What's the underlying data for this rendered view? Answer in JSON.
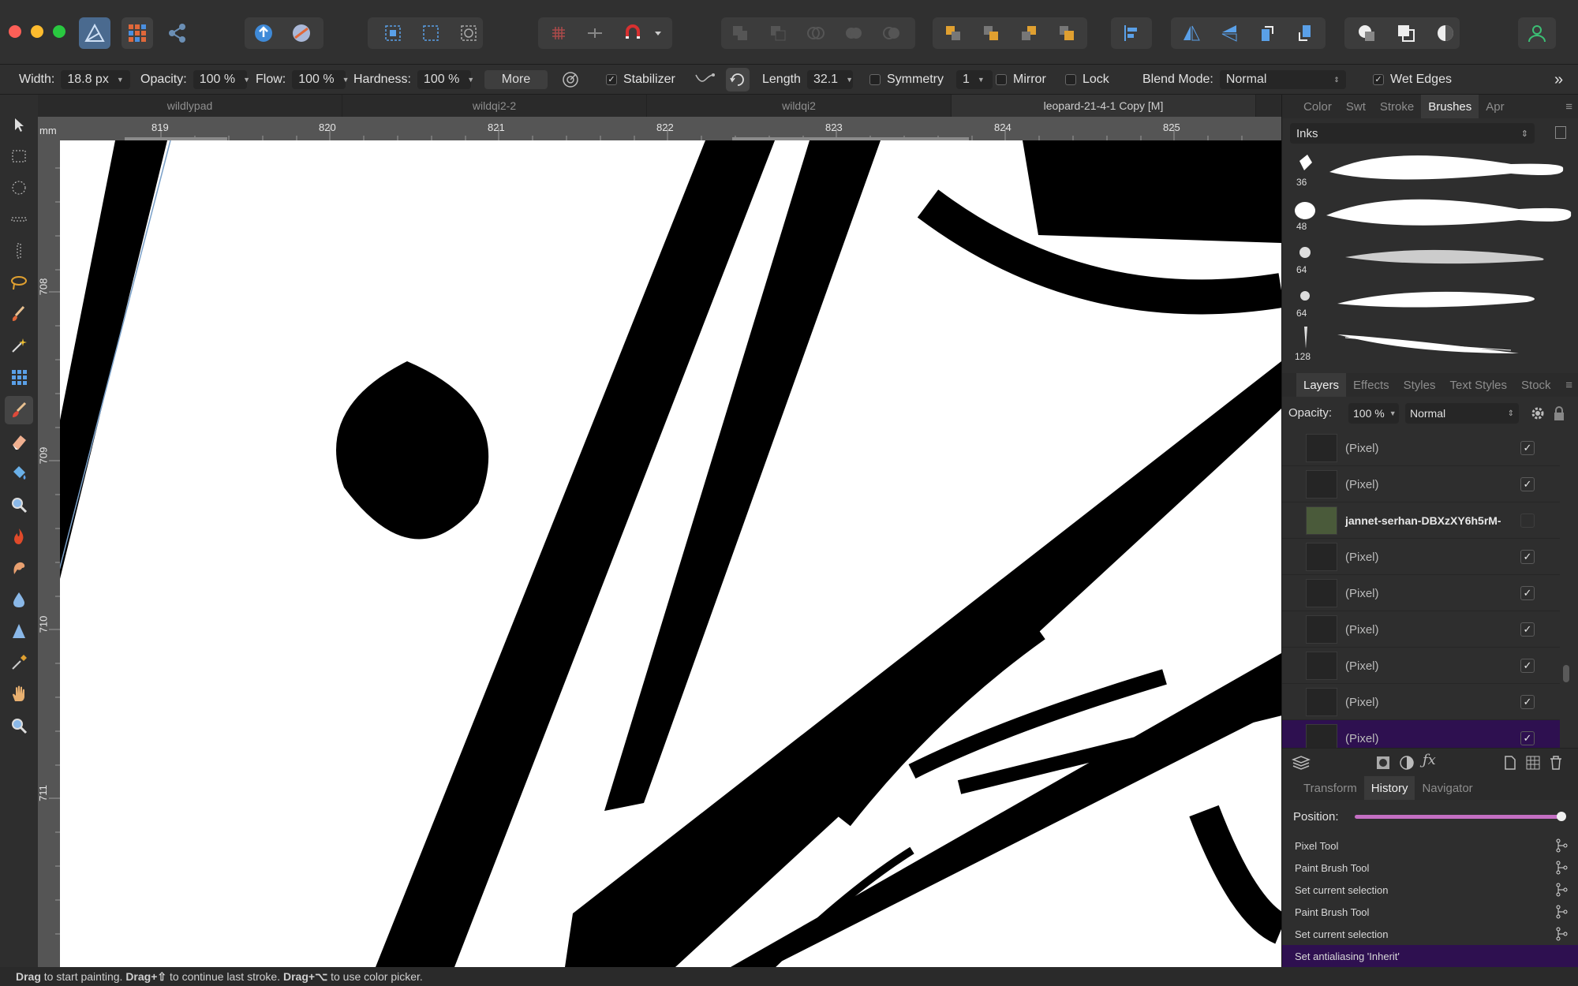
{
  "colors": {
    "accent": "#2e1050",
    "slider": "#c46fc3",
    "canvas": "#ffffff",
    "ink": "#000000"
  },
  "document_tabs": [
    "wildlypad",
    "wildqi2-2",
    "wildqi2",
    "leopard-21-4-1 Copy [M]"
  ],
  "context_toolbar": {
    "width_label": "Width:",
    "width_value": "18.8 px",
    "opacity_label": "Opacity:",
    "opacity_value": "100 %",
    "flow_label": "Flow:",
    "flow_value": "100 %",
    "hardness_label": "Hardness:",
    "hardness_value": "100 %",
    "more_label": "More",
    "stabilizer_label": "Stabilizer",
    "stabilizer_checked": true,
    "length_label": "Length",
    "length_value": "32.1",
    "symmetry_label": "Symmetry",
    "symmetry_count": "1",
    "mirror_label": "Mirror",
    "lock_label": "Lock",
    "blend_label": "Blend Mode:",
    "blend_value": "Normal",
    "wet_edges_label": "Wet Edges",
    "wet_edges_checked": true,
    "overflow_icon": "double-chevron-right-icon"
  },
  "ruler": {
    "unit": "mm",
    "top": [
      "819",
      "820",
      "821",
      "822",
      "823",
      "824",
      "825"
    ],
    "left": [
      "708",
      "709",
      "710",
      "711"
    ]
  },
  "tools": [
    "move-icon",
    "rect-marquee-icon",
    "ellipse-marquee-icon",
    "row-marquee-icon",
    "column-marquee-icon",
    "freehand-selection-icon",
    "selection-brush-icon",
    "magic-wand-icon",
    "grid-icon",
    "paint-brush-icon",
    "eraser-icon",
    "flood-fill-icon",
    "dodge-icon",
    "burn-icon",
    "smudge-icon",
    "blur-icon",
    "sharpen-icon",
    "color-picker-icon",
    "hand-icon",
    "zoom-icon"
  ],
  "brushes_panel": {
    "tabs": [
      "Color",
      "Swt",
      "Stroke",
      "Brushes",
      "Apr"
    ],
    "active_tab": "Brushes",
    "category": "Inks",
    "brushes": [
      {
        "size": "36"
      },
      {
        "size": "48"
      },
      {
        "size": "64"
      },
      {
        "size": "64"
      },
      {
        "size": "128"
      }
    ]
  },
  "layers_panel": {
    "tabs": [
      "Layers",
      "Effects",
      "Styles",
      "Text Styles",
      "Stock"
    ],
    "active_tab": "Layers",
    "opacity_label": "Opacity:",
    "opacity_value": "100 %",
    "blend_value": "Normal",
    "layers": [
      {
        "name": "(Pixel)",
        "visible": true,
        "selected": false,
        "bold": false
      },
      {
        "name": "(Pixel)",
        "visible": true,
        "selected": false,
        "bold": false
      },
      {
        "name": "jannet-serhan-DBXzXY6h5rM-",
        "visible": false,
        "selected": false,
        "bold": true
      },
      {
        "name": "(Pixel)",
        "visible": true,
        "selected": false,
        "bold": false
      },
      {
        "name": "(Pixel)",
        "visible": true,
        "selected": false,
        "bold": false
      },
      {
        "name": "(Pixel)",
        "visible": true,
        "selected": false,
        "bold": false
      },
      {
        "name": "(Pixel)",
        "visible": true,
        "selected": false,
        "bold": false
      },
      {
        "name": "(Pixel)",
        "visible": true,
        "selected": false,
        "bold": false
      },
      {
        "name": "(Pixel)",
        "visible": true,
        "selected": true,
        "bold": false
      }
    ]
  },
  "history_panel": {
    "tabs": [
      "Transform",
      "History",
      "Navigator"
    ],
    "active_tab": "History",
    "position_label": "Position:",
    "position_value": 1.0,
    "items": [
      {
        "label": "Pixel Tool",
        "selected": false
      },
      {
        "label": "Paint Brush Tool",
        "selected": false
      },
      {
        "label": "Set current selection",
        "selected": false
      },
      {
        "label": "Paint Brush Tool",
        "selected": false
      },
      {
        "label": "Set current selection",
        "selected": false
      },
      {
        "label": "Set antialiasing 'Inherit'",
        "selected": true
      }
    ]
  },
  "status": {
    "drag1": "Drag",
    "text1": " to start painting. ",
    "drag2": "Drag",
    "sym2": "+⇧",
    "text2": " to continue last stroke. ",
    "drag3": "Drag",
    "sym3": "+⌥",
    "text3": " to use color picker."
  }
}
